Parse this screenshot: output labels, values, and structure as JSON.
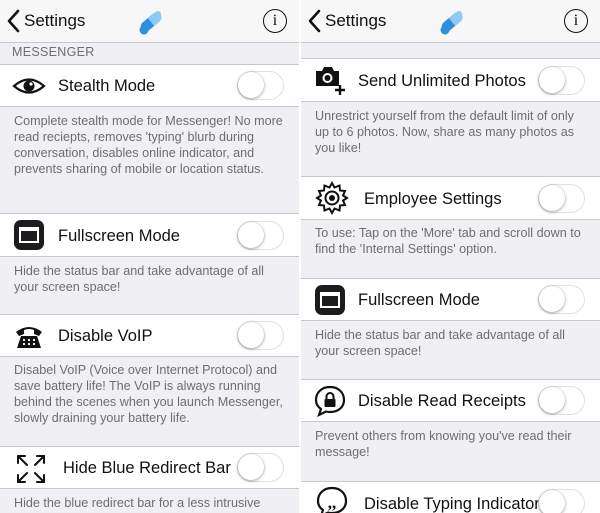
{
  "nav": {
    "back_label": "Settings",
    "info_label": "i"
  },
  "left": {
    "section_header": "MESSENGER",
    "items": [
      {
        "title": "Stealth Mode",
        "icon": "eye-icon",
        "enabled": false,
        "description": "Complete stealth mode for Messenger! No more read reciepts, removes 'typing' blurb during conversation, disables online indicator, and prevents sharing of mobile or location status."
      },
      {
        "title": "Fullscreen Mode",
        "icon": "fullscreen-icon",
        "enabled": false,
        "description": "Hide the status bar and take advantage of all your screen space!"
      },
      {
        "title": "Disable VoIP",
        "icon": "telephone-icon",
        "enabled": false,
        "description": "Disabel VoIP (Voice over Internet Protocol) and save battery life! The VoIP is always running behind the scenes when you launch Messenger, slowly draining your battery life."
      },
      {
        "title": "Hide Blue Redirect Bar",
        "icon": "expand-arrows-icon",
        "enabled": false,
        "description": "Hide the blue redirect bar for a less intrusive"
      }
    ]
  },
  "right": {
    "items": [
      {
        "title": "Send Unlimited Photos",
        "icon": "camera-plus-icon",
        "enabled": false,
        "description": "Unrestrict yourself from the default limit of only up to 6 photos. Now, share as many photos as you like!"
      },
      {
        "title": "Employee Settings",
        "icon": "gear-icon",
        "enabled": false,
        "description": "To use: Tap on the 'More' tab and scroll down to find the 'Internal Settings' option."
      },
      {
        "title": "Fullscreen Mode",
        "icon": "fullscreen-icon",
        "enabled": false,
        "description": "Hide the status bar and take advantage of all your screen space!"
      },
      {
        "title": "Disable Read Receipts",
        "icon": "lock-bubble-icon",
        "enabled": false,
        "description": "Prevent others from knowing you've read their message!"
      },
      {
        "title": "Disable Typing Indicator",
        "icon": "quote-bubble-icon",
        "enabled": false
      }
    ]
  },
  "colors": {
    "accent": "#2d8fe0",
    "background": "#efeff4",
    "separator": "#c8c7cc",
    "secondary_text": "#6d6d72"
  }
}
